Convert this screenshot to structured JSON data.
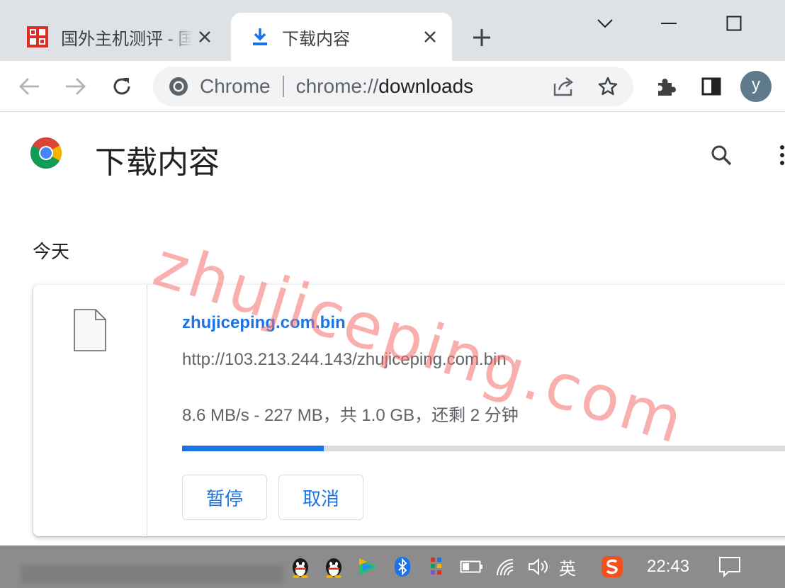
{
  "tabs": [
    {
      "title": "国外主机测评 - 国外VPS，",
      "active": false
    },
    {
      "title": "下载内容",
      "active": true
    }
  ],
  "omnibox": {
    "chip": "Chrome",
    "url_scheme": "chrome://",
    "url_path": "downloads"
  },
  "profile": {
    "initial": "y"
  },
  "page": {
    "title": "下载内容",
    "date_header": "今天"
  },
  "download": {
    "file_name": "zhujiceping.com.bin",
    "url": "http://103.213.244.143/zhujiceping.com.bin",
    "status": "8.6 MB/s - 227 MB，共 1.0 GB，还剩 2 分钟",
    "progress_fraction": 0.227,
    "pause_label": "暂停",
    "cancel_label": "取消"
  },
  "watermark": "zhujiceping.com",
  "taskbar": {
    "ime": "英",
    "clock": "22:43"
  },
  "colors": {
    "accent": "#1a73e8",
    "tabstrip": "#dee1e6",
    "watermark": "#f56e6e"
  }
}
